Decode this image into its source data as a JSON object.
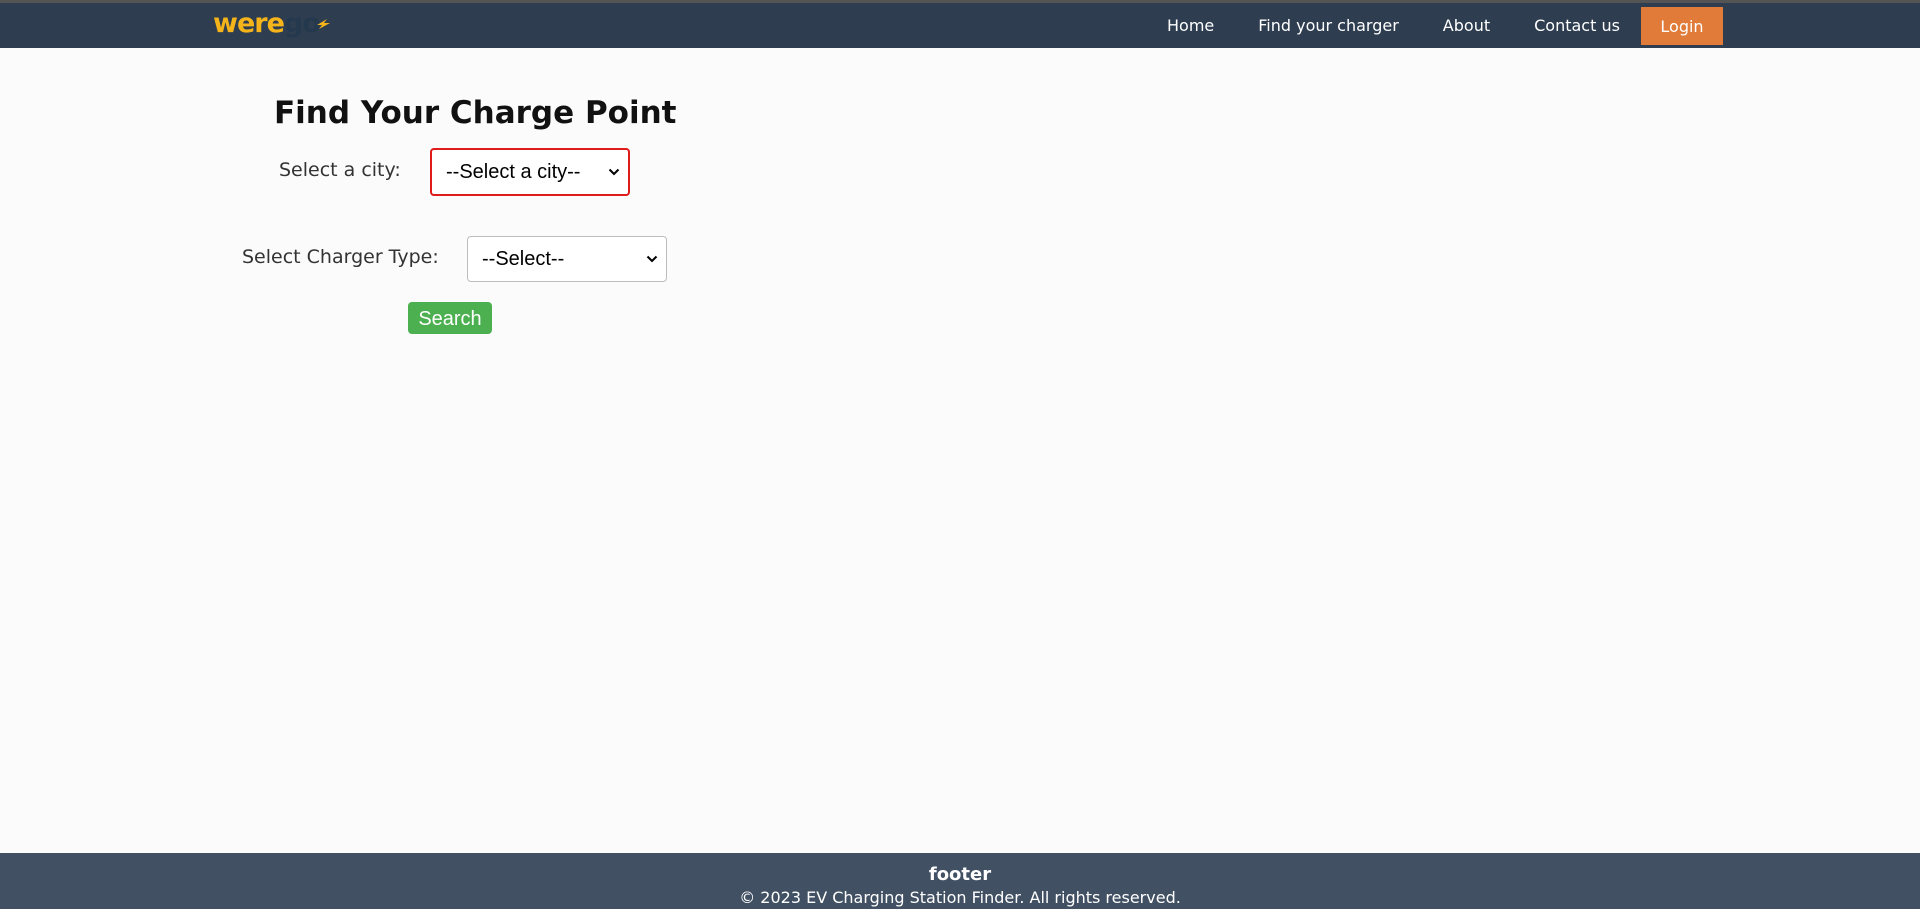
{
  "brand": {
    "logo_part1": "were",
    "logo_part2": "go",
    "colors": {
      "primary": "#f4b41a",
      "secondary": "#25394e"
    }
  },
  "nav": {
    "items": [
      {
        "label": "Home"
      },
      {
        "label": "Find your charger"
      },
      {
        "label": "About"
      },
      {
        "label": "Contact us"
      }
    ],
    "login_label": "Login",
    "colors": {
      "bar": "#2e3e50",
      "login": "#e07b39"
    }
  },
  "main": {
    "title": "Find Your Charge Point",
    "city_label": "Select a city:",
    "city_value": "--Select a city--",
    "charger_label": "Select Charger Type:",
    "charger_value": "--Select--",
    "search_label": "Search",
    "colors": {
      "search": "#4caf50",
      "invalid_border": "#e01b1b"
    }
  },
  "footer": {
    "title": "footer",
    "copyright": "© 2023 EV Charging Station Finder. All rights reserved.",
    "color": "#415163"
  }
}
